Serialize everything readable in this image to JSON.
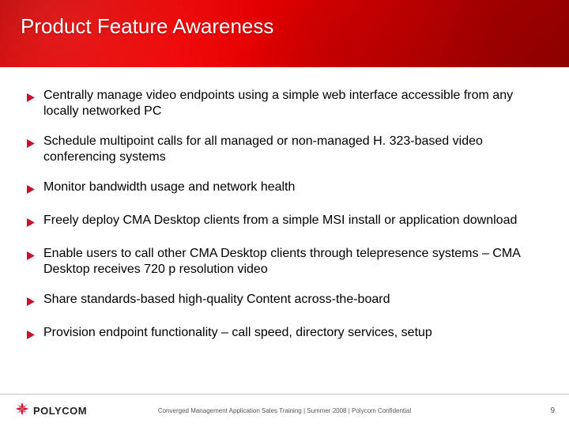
{
  "title": "Product Feature Awareness",
  "bullets": [
    "Centrally manage video endpoints using a simple web interface accessible from any locally networked PC",
    "Schedule multipoint calls for all managed or non-managed H. 323-based video conferencing systems",
    "Monitor bandwidth usage and network health",
    "Freely deploy CMA Desktop clients from a simple MSI install or application download",
    "Enable users to call other CMA Desktop clients through telepresence systems – CMA Desktop receives 720 p resolution video",
    "Share standards-based high-quality Content across-the-board",
    "Provision endpoint functionality – call speed, directory services, setup"
  ],
  "footer": {
    "brand": "POLYCOM",
    "confidential": "Converged Management Application Sales Training  | Summer 2008 |  Polycom Confidential",
    "page": "9"
  },
  "colors": {
    "accent": "#c8102e"
  }
}
